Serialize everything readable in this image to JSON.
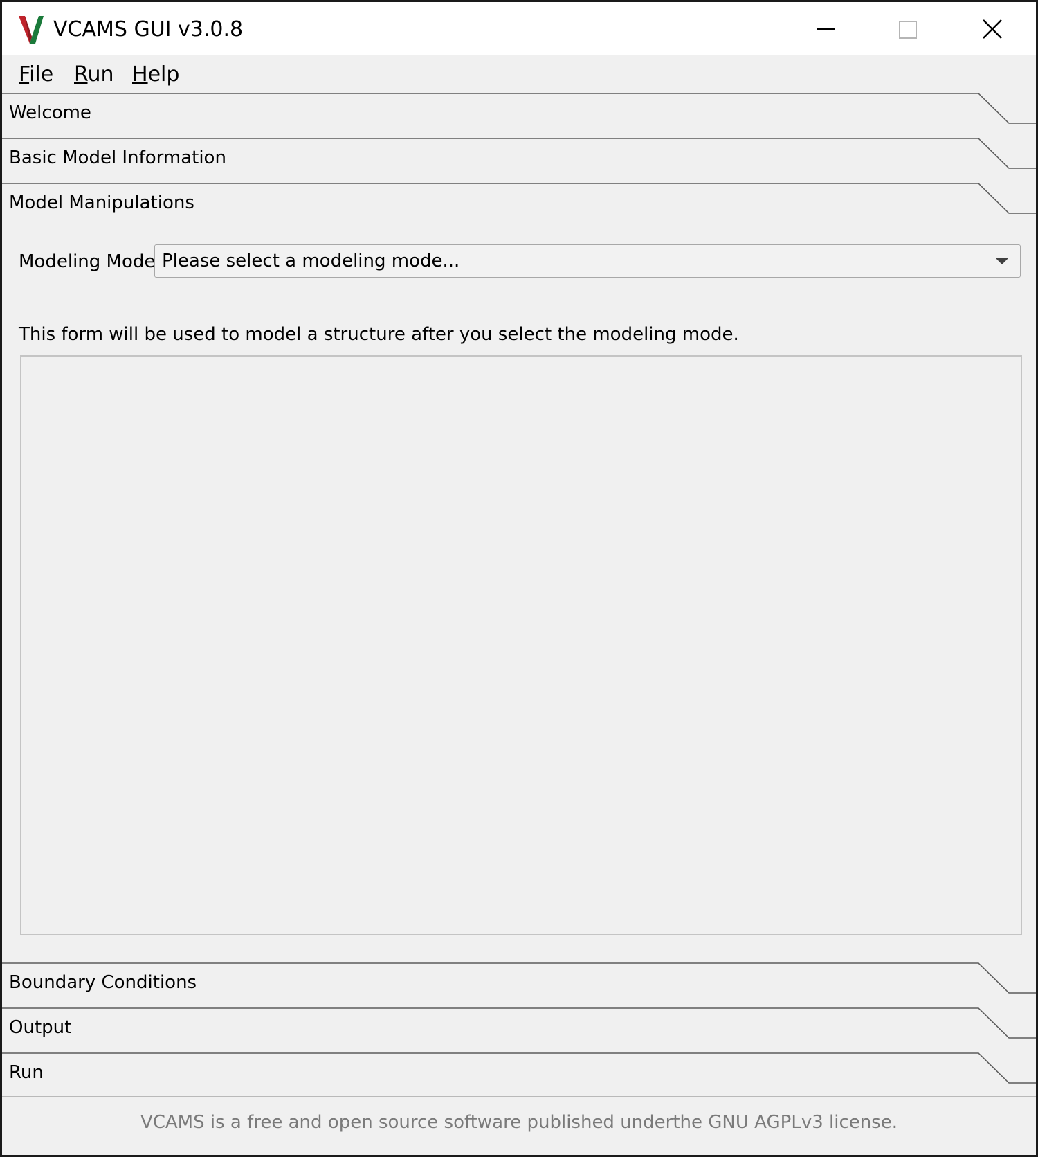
{
  "window": {
    "title": "VCAMS GUI v3.0.8",
    "app_icon": "vcams-v-logo-icon",
    "controls": [
      "minimize-icon",
      "maximize-icon",
      "close-icon"
    ]
  },
  "menu": {
    "file": {
      "first": "F",
      "rest": "ile"
    },
    "run": {
      "first": "R",
      "rest": "un"
    },
    "help": {
      "first": "H",
      "rest": "elp"
    }
  },
  "sections": {
    "welcome": "Welcome",
    "basic_model_information": "Basic Model Information",
    "model_manipulations": "Model Manipulations",
    "boundary_conditions": "Boundary Conditions",
    "output": "Output",
    "run": "Run"
  },
  "model_manipulations": {
    "modeling_mode_label": "Modeling Mode",
    "modeling_mode_value": "Please select a modeling mode...",
    "info_text": "This form will be used to model a structure after you select the modeling mode."
  },
  "footer": {
    "text": "VCAMS is a free and open source software published underthe GNU AGPLv3 license."
  },
  "colors": {
    "window_bg": "#f0f0f0",
    "titlebar_bg": "#ffffff",
    "footer_text": "#7a7a7a",
    "logo_green": "#1a7a3a",
    "logo_red": "#c0232b"
  }
}
